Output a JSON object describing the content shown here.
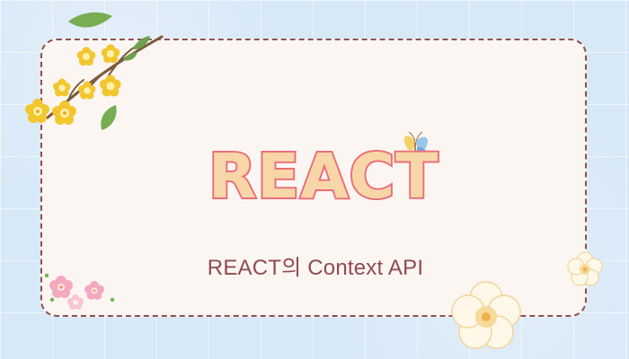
{
  "title": "REACT",
  "subtitle": "REACT의 Context API"
}
